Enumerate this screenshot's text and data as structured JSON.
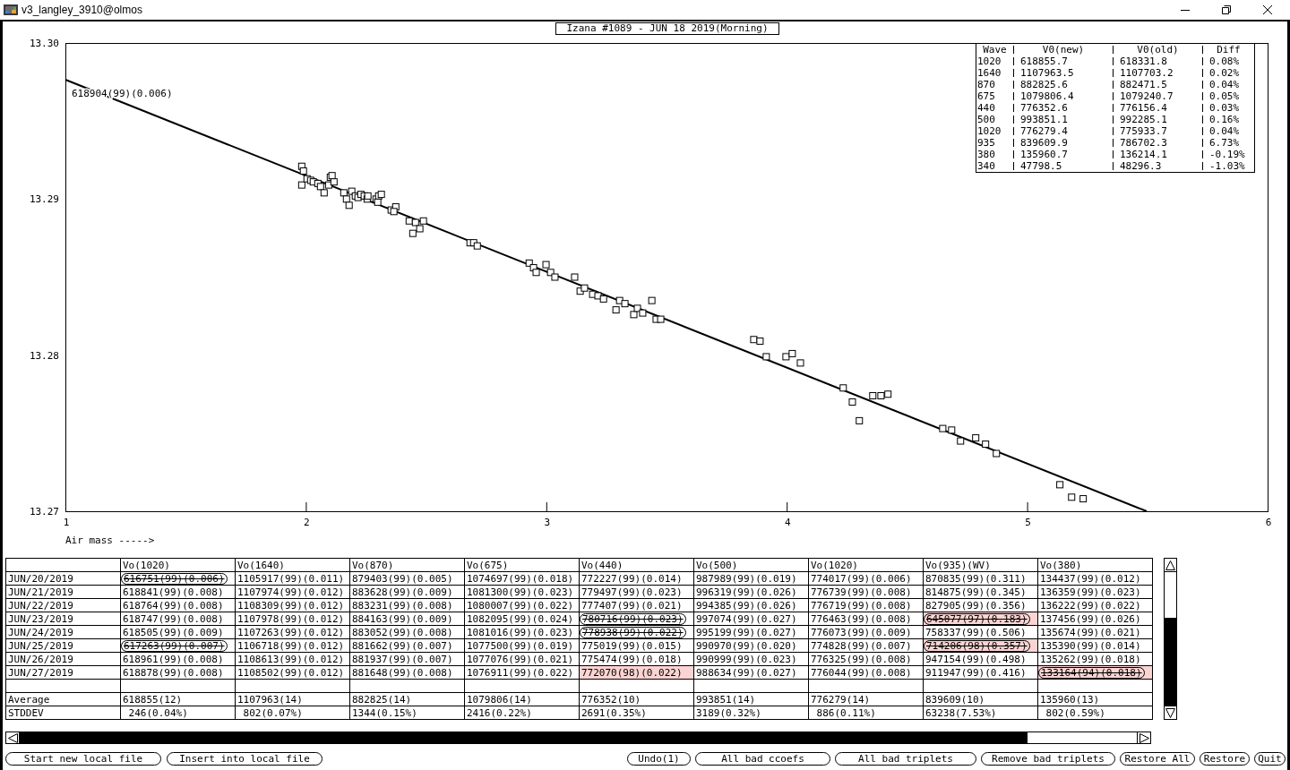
{
  "window": {
    "title": "v3_langley_3910@olmos"
  },
  "chart": {
    "chart_data": {
      "type": "scatter",
      "title": "Izana #1089 - JUN 18 2019(Morning)",
      "xlabel": "Air mass ----->",
      "x": [
        1.983,
        1.99,
        1.983,
        2.005,
        2.02,
        2.031,
        2.05,
        2.061,
        2.076,
        2.095,
        2.102,
        2.109,
        2.117,
        2.158,
        2.169,
        2.18,
        2.191,
        2.206,
        2.217,
        2.229,
        2.243,
        2.255,
        2.258,
        2.292,
        2.303,
        2.314,
        2.299,
        2.355,
        2.374,
        2.366,
        2.43,
        2.445,
        2.456,
        2.474,
        2.489,
        2.683,
        2.698,
        2.713,
        2.929,
        2.947,
        2.958,
        2.999,
        3.018,
        3.036,
        3.118,
        3.141,
        3.159,
        3.193,
        3.215,
        3.238,
        3.29,
        3.305,
        3.327,
        3.364,
        3.379,
        3.401,
        3.439,
        3.457,
        3.476,
        3.863,
        3.889,
        3.915,
        3.997,
        4.023,
        4.057,
        4.235,
        4.273,
        4.302,
        4.358,
        4.392,
        4.421,
        4.649,
        4.686,
        4.723,
        4.786,
        4.827,
        4.872,
        5.136,
        5.185,
        5.233
      ],
      "series": [
        {
          "values": [
            13.2921,
            13.2918,
            13.2909,
            13.2913,
            13.2912,
            13.2911,
            13.291,
            13.2908,
            13.2904,
            13.2909,
            13.2914,
            13.2915,
            13.2911,
            13.2904,
            13.29,
            13.2896,
            13.2905,
            13.2902,
            13.2901,
            13.2903,
            13.2902,
            13.29,
            13.2902,
            13.29,
            13.2902,
            13.2903,
            13.2898,
            13.2893,
            13.2895,
            13.2892,
            13.2886,
            13.2878,
            13.2885,
            13.2881,
            13.2886,
            13.2872,
            13.2872,
            13.287,
            13.2859,
            13.2856,
            13.2853,
            13.2858,
            13.2853,
            13.285,
            13.285,
            13.2841,
            13.2843,
            13.2839,
            13.2838,
            13.2836,
            13.2829,
            13.2835,
            13.2833,
            13.2826,
            13.283,
            13.2827,
            13.2835,
            13.2823,
            13.2823,
            13.281,
            13.2809,
            13.2799,
            13.2799,
            13.2801,
            13.2795,
            13.2779,
            13.277,
            13.2758,
            13.2774,
            13.2774,
            13.2775,
            13.2753,
            13.2752,
            13.2745,
            13.2747,
            13.2743,
            13.2737,
            13.2717,
            13.2709,
            13.2708
          ]
        }
      ],
      "xlim": [
        1,
        6
      ],
      "ylim": [
        13.27,
        13.3
      ],
      "xticks": [
        1,
        2,
        3,
        4,
        5,
        6
      ],
      "yticks": [
        {
          "value": 13.27,
          "label": "13.27"
        },
        {
          "value": 13.28,
          "label": "13.28"
        },
        {
          "value": 13.29,
          "label": "13.29"
        },
        {
          "value": 13.3,
          "label": "13.30"
        }
      ],
      "annotations": [
        "618904(99)(0.006)"
      ]
    },
    "legend": {
      "columns": [
        "Wave",
        "V0(new)",
        "V0(old)",
        "Diff"
      ],
      "rows": [
        [
          "1020",
          "618855.7",
          "618331.8",
          "0.08%"
        ],
        [
          "1640",
          "1107963.5",
          "1107703.2",
          "0.02%"
        ],
        [
          "870",
          "882825.6",
          "882471.5",
          "0.04%"
        ],
        [
          "675",
          "1079806.4",
          "1079240.7",
          "0.05%"
        ],
        [
          "440",
          "776352.6",
          "776156.4",
          "0.03%"
        ],
        [
          "500",
          "993851.1",
          "992285.1",
          "0.16%"
        ],
        [
          "1020",
          "776279.4",
          "775933.7",
          "0.04%"
        ],
        [
          "935",
          "839609.9",
          "786702.3",
          "6.73%"
        ],
        [
          "380",
          "135960.7",
          "136214.1",
          "-0.19%"
        ],
        [
          "340",
          "47798.5",
          "48296.3",
          "-1.03%"
        ]
      ]
    }
  },
  "table": {
    "columns": [
      "Vo(1020)",
      "Vo(1640)",
      "Vo(870)",
      "Vo(675)",
      "Vo(440)",
      "Vo(500)",
      "Vo(1020)",
      "Vo(935)(WV)",
      "Vo(380)"
    ],
    "rows": [
      {
        "label": "JUN/20/2019",
        "cells": [
          {
            "text": "616751(99)(0.006)",
            "struck": true,
            "flagged": false
          },
          {
            "text": "1105917(99)(0.011)",
            "struck": false,
            "flagged": false
          },
          {
            "text": "879403(99)(0.005)",
            "struck": false,
            "flagged": false
          },
          {
            "text": "1074697(99)(0.018)",
            "struck": false,
            "flagged": false
          },
          {
            "text": "772227(99)(0.014)",
            "struck": false,
            "flagged": false
          },
          {
            "text": "987989(99)(0.019)",
            "struck": false,
            "flagged": false
          },
          {
            "text": "774017(99)(0.006)",
            "struck": false,
            "flagged": false
          },
          {
            "text": "870835(99)(0.311)",
            "struck": false,
            "flagged": false
          },
          {
            "text": "134437(99)(0.012)",
            "struck": false,
            "flagged": false
          }
        ]
      },
      {
        "label": "JUN/21/2019",
        "cells": [
          {
            "text": "618841(99)(0.008)",
            "struck": false,
            "flagged": false
          },
          {
            "text": "1107974(99)(0.012)",
            "struck": false,
            "flagged": false
          },
          {
            "text": "883628(99)(0.009)",
            "struck": false,
            "flagged": false
          },
          {
            "text": "1081300(99)(0.023)",
            "struck": false,
            "flagged": false
          },
          {
            "text": "779497(99)(0.023)",
            "struck": false,
            "flagged": false
          },
          {
            "text": "996319(99)(0.026)",
            "struck": false,
            "flagged": false
          },
          {
            "text": "776739(99)(0.008)",
            "struck": false,
            "flagged": false
          },
          {
            "text": "814875(99)(0.345)",
            "struck": false,
            "flagged": false
          },
          {
            "text": "136359(99)(0.023)",
            "struck": false,
            "flagged": false
          }
        ]
      },
      {
        "label": "JUN/22/2019",
        "cells": [
          {
            "text": "618764(99)(0.008)",
            "struck": false,
            "flagged": false
          },
          {
            "text": "1108309(99)(0.012)",
            "struck": false,
            "flagged": false
          },
          {
            "text": "883231(99)(0.008)",
            "struck": false,
            "flagged": false
          },
          {
            "text": "1080007(99)(0.022)",
            "struck": false,
            "flagged": false
          },
          {
            "text": "777407(99)(0.021)",
            "struck": false,
            "flagged": false
          },
          {
            "text": "994385(99)(0.026)",
            "struck": false,
            "flagged": false
          },
          {
            "text": "776719(99)(0.008)",
            "struck": false,
            "flagged": false
          },
          {
            "text": "827905(99)(0.356)",
            "struck": false,
            "flagged": false
          },
          {
            "text": "136222(99)(0.022)",
            "struck": false,
            "flagged": false
          }
        ]
      },
      {
        "label": "JUN/23/2019",
        "cells": [
          {
            "text": "618747(99)(0.008)",
            "struck": false,
            "flagged": false
          },
          {
            "text": "1107978(99)(0.012)",
            "struck": false,
            "flagged": false
          },
          {
            "text": "884163(99)(0.009)",
            "struck": false,
            "flagged": false
          },
          {
            "text": "1082095(99)(0.024)",
            "struck": false,
            "flagged": false
          },
          {
            "text": "780716(99)(0.023)",
            "struck": true,
            "flagged": false
          },
          {
            "text": "997074(99)(0.027)",
            "struck": false,
            "flagged": false
          },
          {
            "text": "776463(99)(0.008)",
            "struck": false,
            "flagged": false
          },
          {
            "text": "645077(97)(0.183)",
            "struck": true,
            "flagged": true
          },
          {
            "text": "137456(99)(0.026)",
            "struck": false,
            "flagged": false
          }
        ]
      },
      {
        "label": "JUN/24/2019",
        "cells": [
          {
            "text": "618505(99)(0.009)",
            "struck": false,
            "flagged": false
          },
          {
            "text": "1107263(99)(0.012)",
            "struck": false,
            "flagged": false
          },
          {
            "text": "883052(99)(0.008)",
            "struck": false,
            "flagged": false
          },
          {
            "text": "1081016(99)(0.023)",
            "struck": false,
            "flagged": false
          },
          {
            "text": "778938(99)(0.022)",
            "struck": true,
            "flagged": false
          },
          {
            "text": "995199(99)(0.027)",
            "struck": false,
            "flagged": false
          },
          {
            "text": "776073(99)(0.009)",
            "struck": false,
            "flagged": false
          },
          {
            "text": "758337(99)(0.506)",
            "struck": false,
            "flagged": false
          },
          {
            "text": "135674(99)(0.021)",
            "struck": false,
            "flagged": false
          }
        ]
      },
      {
        "label": "JUN/25/2019",
        "cells": [
          {
            "text": "617263(99)(0.007)",
            "struck": true,
            "flagged": false
          },
          {
            "text": "1106718(99)(0.012)",
            "struck": false,
            "flagged": false
          },
          {
            "text": "881662(99)(0.007)",
            "struck": false,
            "flagged": false
          },
          {
            "text": "1077500(99)(0.019)",
            "struck": false,
            "flagged": false
          },
          {
            "text": "775019(99)(0.015)",
            "struck": false,
            "flagged": false
          },
          {
            "text": "990970(99)(0.020)",
            "struck": false,
            "flagged": false
          },
          {
            "text": "774828(99)(0.007)",
            "struck": false,
            "flagged": false
          },
          {
            "text": "714206(98)(0.357)",
            "struck": true,
            "flagged": true
          },
          {
            "text": "135390(99)(0.014)",
            "struck": false,
            "flagged": false
          }
        ]
      },
      {
        "label": "JUN/26/2019",
        "cells": [
          {
            "text": "618961(99)(0.008)",
            "struck": false,
            "flagged": false
          },
          {
            "text": "1108613(99)(0.012)",
            "struck": false,
            "flagged": false
          },
          {
            "text": "881937(99)(0.007)",
            "struck": false,
            "flagged": false
          },
          {
            "text": "1077076(99)(0.021)",
            "struck": false,
            "flagged": false
          },
          {
            "text": "775474(99)(0.018)",
            "struck": false,
            "flagged": false
          },
          {
            "text": "990999(99)(0.023)",
            "struck": false,
            "flagged": false
          },
          {
            "text": "776325(99)(0.008)",
            "struck": false,
            "flagged": false
          },
          {
            "text": "947154(99)(0.498)",
            "struck": false,
            "flagged": false
          },
          {
            "text": "135262(99)(0.018)",
            "struck": false,
            "flagged": false
          }
        ]
      },
      {
        "label": "JUN/27/2019",
        "cells": [
          {
            "text": "618878(99)(0.008)",
            "struck": false,
            "flagged": false
          },
          {
            "text": "1108502(99)(0.012)",
            "struck": false,
            "flagged": false
          },
          {
            "text": "881648(99)(0.008)",
            "struck": false,
            "flagged": false
          },
          {
            "text": "1076911(99)(0.022)",
            "struck": false,
            "flagged": false
          },
          {
            "text": "772070(98)(0.022)",
            "struck": false,
            "flagged": true
          },
          {
            "text": "988634(99)(0.027)",
            "struck": false,
            "flagged": false
          },
          {
            "text": "776044(99)(0.008)",
            "struck": false,
            "flagged": false
          },
          {
            "text": "911947(99)(0.416)",
            "struck": false,
            "flagged": false
          },
          {
            "text": "133164(94)(0.018)",
            "struck": true,
            "flagged": true
          }
        ]
      }
    ],
    "summary_rows": [
      {
        "label": "Average",
        "cells": [
          "618855(12)",
          "1107963(14)",
          "882825(14)",
          "1079806(14)",
          "776352(10)",
          "993851(14)",
          "776279(14)",
          "839609(10)",
          "135960(13)"
        ]
      },
      {
        "label": "STDDEV",
        "cells": [
          " 246(0.04%)",
          " 802(0.07%)",
          "1344(0.15%)",
          "2416(0.22%)",
          "2691(0.35%)",
          "3189(0.32%)",
          " 886(0.11%)",
          "63238(7.53%)",
          " 802(0.59%)"
        ]
      }
    ]
  },
  "toolbar": {
    "left": [
      "Start new local file",
      "Insert into local file"
    ],
    "right": [
      "Undo(1)",
      "All bad ccoefs",
      "All bad triplets",
      "Remove bad triplets",
      "Restore All",
      "Restore",
      "Quit"
    ]
  }
}
